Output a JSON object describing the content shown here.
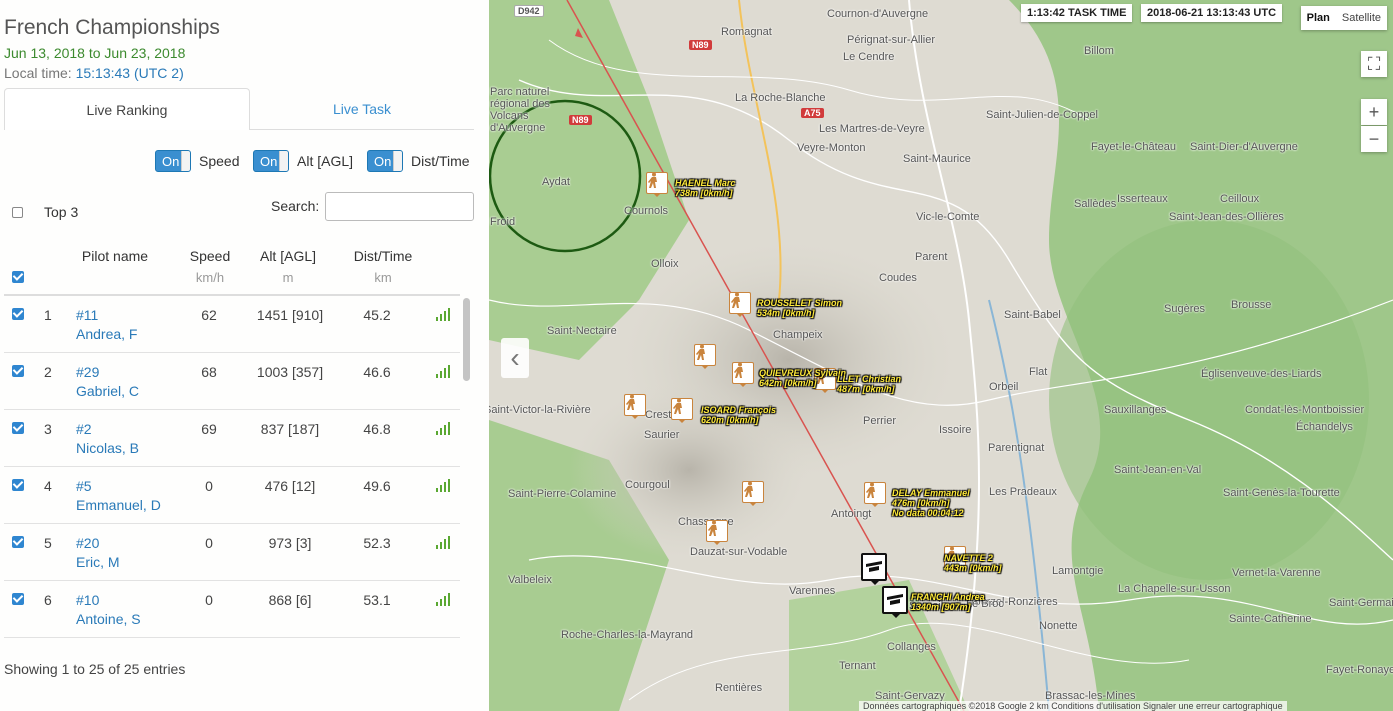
{
  "panel": {
    "title": "French Championships",
    "dates": "Jun 13, 2018 to Jun 23, 2018",
    "local_time_label": "Local time:",
    "local_time_value": "15:13:43 (UTC 2)",
    "tabs": [
      {
        "label": "Live Ranking",
        "active": true
      },
      {
        "label": "Live Task",
        "active": false
      }
    ],
    "toggles": [
      {
        "state": "On",
        "label": "Speed"
      },
      {
        "state": "On",
        "label": "Alt [AGL]"
      },
      {
        "state": "On",
        "label": "Dist/Time"
      }
    ],
    "top3_label": "Top 3",
    "search_label": "Search:",
    "search_value": "",
    "columns": [
      {
        "label": "Pilot name",
        "unit": ""
      },
      {
        "label": "Speed",
        "unit": "km/h"
      },
      {
        "label": "Alt [AGL]",
        "unit": "m"
      },
      {
        "label": "Dist/Time",
        "unit": "km"
      }
    ],
    "rows": [
      {
        "rank": "1",
        "id": "#11",
        "name": "Andrea, F",
        "speed": "62",
        "alt": "1451 [910]",
        "dist": "45.2"
      },
      {
        "rank": "2",
        "id": "#29",
        "name": "Gabriel, C",
        "speed": "68",
        "alt": "1003 [357]",
        "dist": "46.6"
      },
      {
        "rank": "3",
        "id": "#2",
        "name": "Nicolas, B",
        "speed": "69",
        "alt": "837 [187]",
        "dist": "46.8"
      },
      {
        "rank": "4",
        "id": "#5",
        "name": "Emmanuel, D",
        "speed": "0",
        "alt": "476 [12]",
        "dist": "49.6"
      },
      {
        "rank": "5",
        "id": "#20",
        "name": "Eric, M",
        "speed": "0",
        "alt": "973 [3]",
        "dist": "52.3"
      },
      {
        "rank": "6",
        "id": "#10",
        "name": "Antoine, S",
        "speed": "0",
        "alt": "868 [6]",
        "dist": "53.1"
      }
    ],
    "entries_text": "Showing 1 to 25 of 25 entries"
  },
  "map": {
    "task_time": "1:13:42 TASK TIME",
    "utc_time": "2018-06-21 13:13:43 UTC",
    "map_types": [
      "Plan",
      "Satellite"
    ],
    "roads": [
      "D942",
      "N89",
      "N89",
      "A75"
    ],
    "towns": [
      "Cournon-d'Auvergne",
      "Romagnat",
      "Pérignat-sur-Allier",
      "Billom",
      "Le Cendre",
      "Parc naturel régional des Volcans d'Auvergne",
      "La Roche-Blanche",
      "Les Martres-de-Veyre",
      "Saint-Julien-de-Coppel",
      "Veyre-Monton",
      "Saint-Maurice",
      "Fayet-le-Château",
      "Saint-Dier-d'Auvergne",
      "Aydat",
      "Cournols",
      "Vic-le-Comte",
      "Sallèdes",
      "Isserteaux",
      "Ceilloux",
      "Saint-Jean-des-Ollières",
      "Froid",
      "Olloix",
      "Parent",
      "Coudes",
      "Champeix",
      "Saint-Nectaire",
      "Saint-Babel",
      "Sugères",
      "Brousse",
      "Flat",
      "Orbeil",
      "Églisenveuve-des-Liards",
      "Sauxillanges",
      "Condat-lès-Montboissier",
      "Échandelys",
      "Saint-Victor-la-Rivière",
      "Crest",
      "Saurier",
      "Perrier",
      "Issoire",
      "Parentignat",
      "Saint-Jean-en-Val",
      "Courgoul",
      "Saint-Pierre-Colamine",
      "Les Pradeaux",
      "Saint-Genès-la-Tourette",
      "Antoingt",
      "Chassagne",
      "Dauzat-sur-Vodable",
      "Lamontgie",
      "Vernet-la-Varenne",
      "Valbeleix",
      "La Chapelle-sur-Usson",
      "Saint-Germain",
      "Roche-Charles-la-Mayrand",
      "Collanges",
      "Sainte-Catherine",
      "Fayet-Ronaye",
      "Rentières",
      "Saint-Gervazy",
      "Brassac-les-Mines",
      "Ternant",
      "Varennes",
      "Tourzel-Ronzières",
      "Sarpoil",
      "Le Broc",
      "Nonette"
    ],
    "pilot_labels": [
      {
        "name": "HAENEL Marc",
        "info": "738m [0km/h]"
      },
      {
        "name": "ROUSSELET Simon",
        "info": "534m [0km/h]"
      },
      {
        "name": "QUIEVREUX Sylvain",
        "info": "642m [0km/h]"
      },
      {
        "name": "LLET Christian",
        "info": "487m [0km/h]"
      },
      {
        "name": "ISOARD François",
        "info": "620m [0km/h]"
      },
      {
        "name": "DELAY Emmanuel",
        "info": "476m [0km/h]",
        "extra": "No data 00:04:12"
      },
      {
        "name": "NAVETTE 2",
        "info": "443m [0km/h]"
      },
      {
        "name": "FRANCHI Andrea",
        "info": "1340m [907m]"
      }
    ],
    "attribution": "Données cartographiques ©2018 Google   2 km   Conditions d'utilisation   Signaler une erreur cartographique",
    "colors": {
      "track": "#d9534f",
      "cylinder": "#1d5a12",
      "pilot_border": "#c9843d",
      "label": "#ffea3a"
    }
  }
}
